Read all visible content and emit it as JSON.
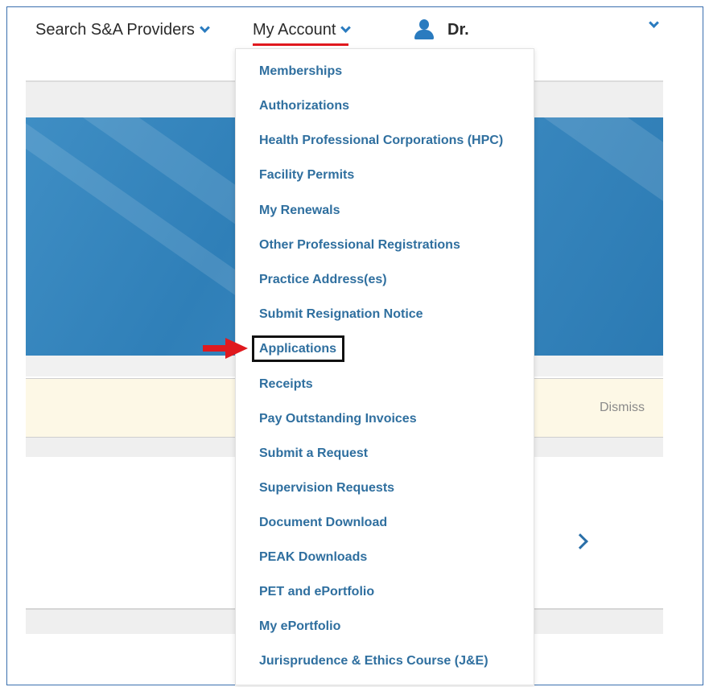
{
  "nav": {
    "search_label": "Search S&A Providers",
    "account_label": "My Account",
    "user_label": "Dr."
  },
  "notice": {
    "dismiss_label": "Dismiss"
  },
  "menu": {
    "items": [
      "Memberships",
      "Authorizations",
      "Health Professional Corporations (HPC)",
      "Facility Permits",
      "My Renewals",
      "Other Professional Registrations",
      "Practice Address(es)",
      "Submit Resignation Notice",
      "Applications",
      "Receipts",
      "Pay Outstanding Invoices",
      "Submit a Request",
      "Supervision Requests",
      "Document Download",
      "PEAK Downloads",
      "PET and ePortfolio",
      "My ePortfolio",
      "Jurisprudence & Ethics Course (J&E)"
    ],
    "highlighted": "Applications"
  },
  "colors": {
    "accent": "#2a7bbf",
    "menu_text": "#2f6f9f",
    "underline": "#e0191e",
    "annotation_arrow": "#e0191e"
  },
  "icons": [
    "chevron-down-icon",
    "user-icon",
    "chevron-right-icon",
    "red-arrow-annotation"
  ]
}
